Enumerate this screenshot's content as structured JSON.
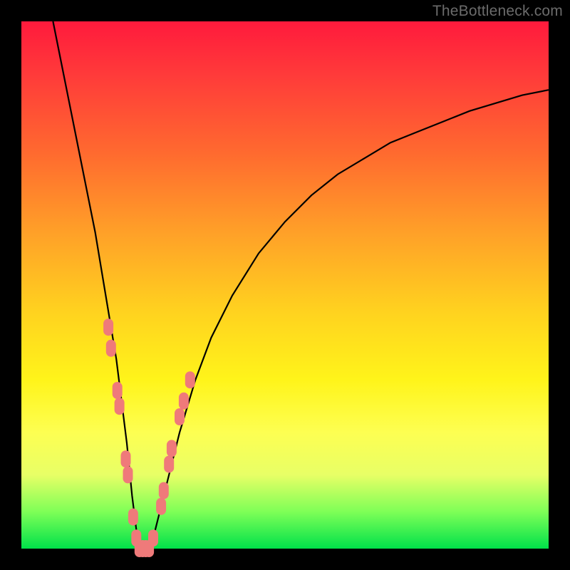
{
  "watermark": "TheBottleneck.com",
  "chart_data": {
    "type": "line",
    "title": "",
    "xlabel": "",
    "ylabel": "",
    "xlim": [
      0,
      100
    ],
    "ylim": [
      0,
      100
    ],
    "grid": false,
    "legend": false,
    "series": [
      {
        "name": "bottleneck-curve",
        "x": [
          6,
          8,
          10,
          12,
          14,
          16,
          17,
          18,
          19,
          20,
          21,
          22,
          23,
          24,
          25,
          26,
          28,
          30,
          33,
          36,
          40,
          45,
          50,
          55,
          60,
          65,
          70,
          75,
          80,
          85,
          90,
          95,
          100
        ],
        "y": [
          100,
          90,
          80,
          70,
          60,
          48,
          42,
          36,
          28,
          20,
          10,
          2,
          0,
          0,
          2,
          6,
          14,
          22,
          32,
          40,
          48,
          56,
          62,
          67,
          71,
          74,
          77,
          79,
          81,
          83,
          84.5,
          86,
          87
        ]
      }
    ],
    "markers": {
      "name": "highlight-dots",
      "color": "#ef7a7a",
      "points": [
        {
          "x": 16.5,
          "y": 42
        },
        {
          "x": 17.0,
          "y": 38
        },
        {
          "x": 18.2,
          "y": 30
        },
        {
          "x": 18.6,
          "y": 27
        },
        {
          "x": 19.8,
          "y": 17
        },
        {
          "x": 20.2,
          "y": 14
        },
        {
          "x": 21.2,
          "y": 6
        },
        {
          "x": 21.8,
          "y": 2
        },
        {
          "x": 22.4,
          "y": 0
        },
        {
          "x": 23.0,
          "y": 0
        },
        {
          "x": 23.6,
          "y": 0
        },
        {
          "x": 24.2,
          "y": 0
        },
        {
          "x": 25.0,
          "y": 2
        },
        {
          "x": 26.5,
          "y": 8
        },
        {
          "x": 27.0,
          "y": 11
        },
        {
          "x": 28.0,
          "y": 16
        },
        {
          "x": 28.5,
          "y": 19
        },
        {
          "x": 30.0,
          "y": 25
        },
        {
          "x": 30.8,
          "y": 28
        },
        {
          "x": 32.0,
          "y": 32
        }
      ]
    }
  }
}
